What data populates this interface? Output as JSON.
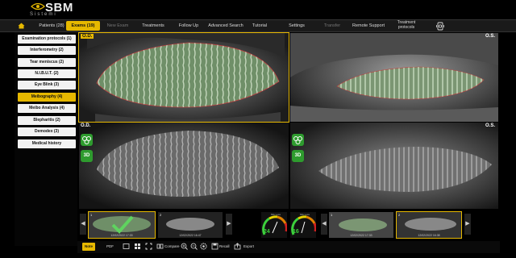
{
  "app": {
    "logo_text": "SBM",
    "logo_sub": "Sistemi"
  },
  "menu": {
    "items": [
      {
        "label": "Patients (28)"
      },
      {
        "label": "Exams (19)"
      },
      {
        "label": "New Exam"
      },
      {
        "label": "Treatments"
      },
      {
        "label": "Follow Up"
      },
      {
        "label": "Advanced Search"
      },
      {
        "label": "Tutorial"
      },
      {
        "label": "Settings"
      },
      {
        "label": "Transfer"
      },
      {
        "label": "Remote Support"
      },
      {
        "label": "Treatment protocols"
      }
    ],
    "active": "Exams (19)"
  },
  "sidebar": {
    "items": [
      {
        "label": "Examination protocols (1)"
      },
      {
        "label": "Interferometry (2)"
      },
      {
        "label": "Tear meniscus (2)"
      },
      {
        "label": "N.I.B.U.T. (2)"
      },
      {
        "label": "Eye Blink (3)"
      },
      {
        "label": "Meibography (4)"
      },
      {
        "label": "Meibo Analysis (4)"
      },
      {
        "label": "Blepharitis (2)"
      },
      {
        "label": "Demodex (3)"
      },
      {
        "label": "Medical history"
      }
    ],
    "active": "Meibography (4)"
  },
  "panes": {
    "top_left_tag": "O.D.",
    "top_right_tag": "O.S.",
    "bottom_left_tag": "O.D.",
    "bottom_right_tag": "O.S.",
    "btn_3d": "3D"
  },
  "thumbs": {
    "items": [
      {
        "num": "1",
        "date": "12/02/2022 17:33"
      },
      {
        "num": "2",
        "date": "12/02/2022 16:47"
      },
      {
        "num": "1",
        "date": "12/02/2022 17:33"
      },
      {
        "num": "2",
        "date": "12/02/2022 16:38"
      }
    ],
    "gauges": [
      {
        "caption": "MG Loss",
        "value": "24"
      },
      {
        "caption": "MG Loss",
        "value": "16"
      }
    ]
  },
  "toolbar": {
    "note": "Note",
    "pdf": "PDF",
    "compare": "Compare",
    "recall": "Recall",
    "export": "Export"
  },
  "colors": {
    "accent": "#e6b800",
    "meibo_green": "#2e9b2e"
  }
}
